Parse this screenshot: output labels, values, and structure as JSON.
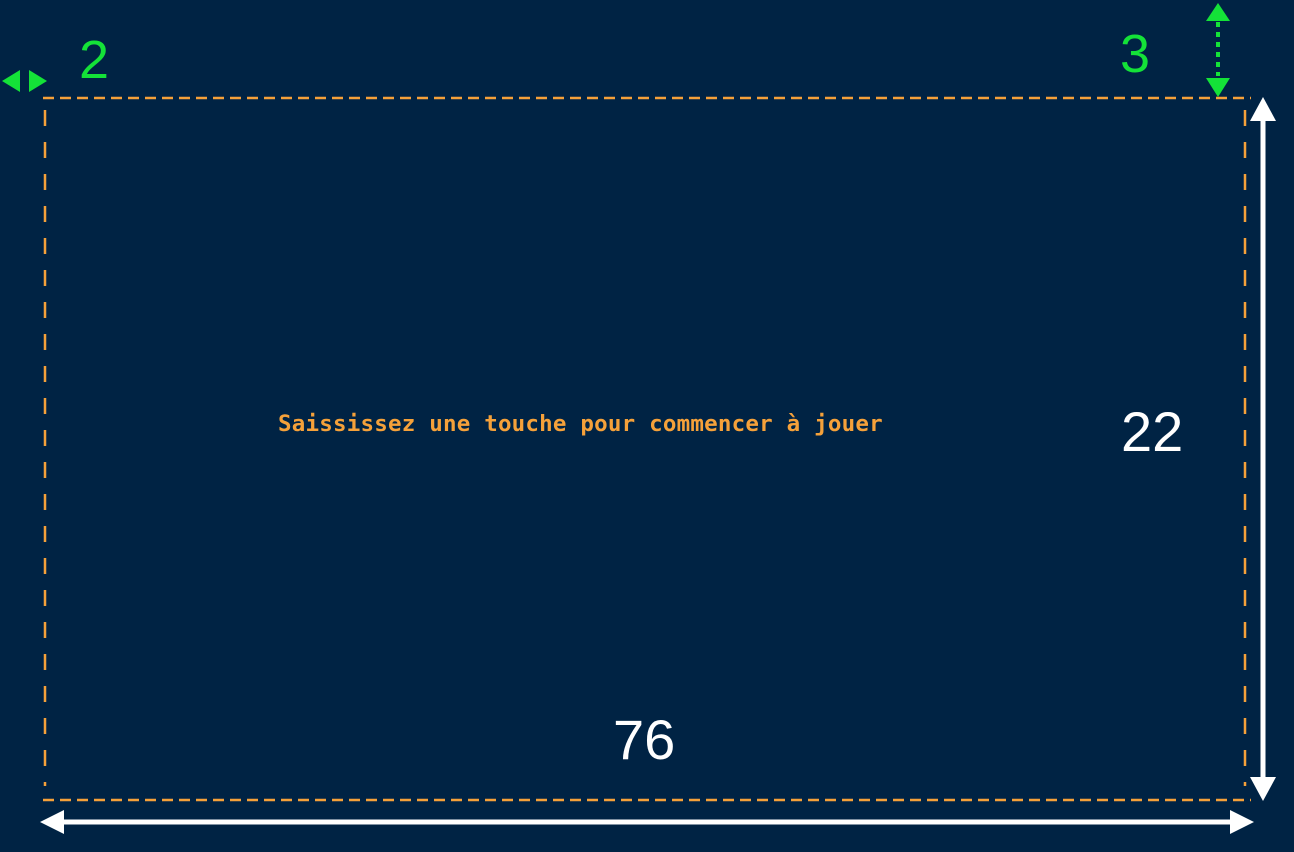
{
  "colors": {
    "background": "#002344",
    "frame_border": "#F5A13A",
    "message_text": "#F5A13A",
    "offset_annotation": "#14E238",
    "size_annotation": "#FFFFFF"
  },
  "game": {
    "start_message": "Saississez une touche pour commencer à jouer"
  },
  "annotations": {
    "left_offset": "2",
    "top_offset": "3",
    "frame_height": "22",
    "frame_width": "76"
  },
  "icons": {
    "left_offset_arrow": "double-headed-horizontal-arrow",
    "top_offset_arrow": "dotted-double-headed-vertical-arrow",
    "height_arrow": "double-headed-vertical-arrow",
    "width_arrow": "double-headed-horizontal-arrow"
  }
}
